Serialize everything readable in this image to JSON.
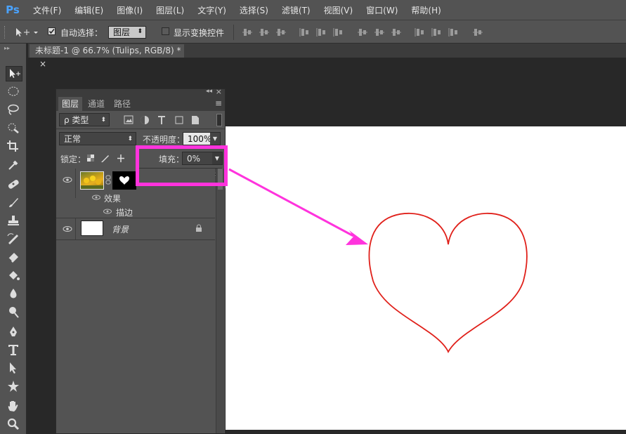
{
  "app": {
    "logo": "Ps"
  },
  "menu": [
    "文件(F)",
    "编辑(E)",
    "图像(I)",
    "图层(L)",
    "文字(Y)",
    "选择(S)",
    "滤镜(T)",
    "视图(V)",
    "窗口(W)",
    "帮助(H)"
  ],
  "options": {
    "auto_select_label": "自动选择：",
    "auto_select_value": "图层",
    "show_transform_label": "显示变换控件",
    "auto_select_checked": true,
    "show_transform_checked": false
  },
  "document": {
    "tab_title": "未标题-1 @ 66.7% (Tulips, RGB/8) *",
    "close": "×"
  },
  "layers_panel": {
    "header_collapse": "◂◂",
    "header_close": "×",
    "tabs": [
      "图层",
      "通道",
      "路径"
    ],
    "menu_icon": "≡",
    "filter_label": "ρ 类型",
    "blend_mode": "正常",
    "opacity_label": "不透明度：",
    "opacity_value": "100%",
    "lock_label": "锁定：",
    "fill_label": "填充：",
    "fill_value": "0%",
    "layers": [
      {
        "name": "",
        "effects_label": "效果",
        "effect": "描边",
        "visible": true,
        "has_mask": true
      },
      {
        "name": "背景",
        "visible": true,
        "locked": true
      }
    ]
  },
  "colors": {
    "highlight": "#ff33dd",
    "heart_stroke": "#e0201a",
    "canvas": "#ffffff",
    "ui_bg": "#535353"
  }
}
